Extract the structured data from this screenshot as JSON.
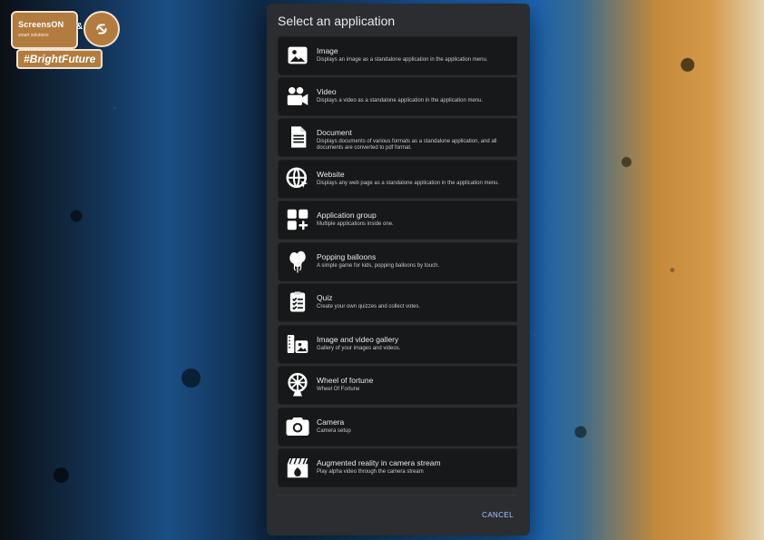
{
  "brand": {
    "left_name": "ScreensON",
    "left_sub": "smart solutions",
    "amp": "&",
    "hashtag": "#BrightFuture"
  },
  "dialog": {
    "title": "Select an application",
    "cancel_label": "CANCEL",
    "items": [
      {
        "icon": "image-icon",
        "title": "Image",
        "desc": "Displays an image as a standalone application in the application menu."
      },
      {
        "icon": "video-camera-icon",
        "title": "Video",
        "desc": "Displays a video as a standalone application in the application menu."
      },
      {
        "icon": "document-icon",
        "title": "Document",
        "desc": "Displays documents of various formats as a standalone application, and all documents are converted to pdf format."
      },
      {
        "icon": "website-globe-icon",
        "title": "Website",
        "desc": "Displays any web page as a standalone application in the application menu."
      },
      {
        "icon": "app-group-icon",
        "title": "Application group",
        "desc": "Multiple applications inside one."
      },
      {
        "icon": "balloons-icon",
        "title": "Popping balloons",
        "desc": "A simple game for kids, popping balloons by touch."
      },
      {
        "icon": "quiz-checklist-icon",
        "title": "Quiz",
        "desc": "Create your own quizzes and collect votes."
      },
      {
        "icon": "gallery-icon",
        "title": "Image and video gallery",
        "desc": "Gallery of your images and videos."
      },
      {
        "icon": "wheel-of-fortune-icon",
        "title": "Wheel of fortune",
        "desc": "Wheel Of Fortune"
      },
      {
        "icon": "camera-icon",
        "title": "Camera",
        "desc": "Camera setup"
      },
      {
        "icon": "clapperboard-ar-icon",
        "title": "Augmented reality in camera stream",
        "desc": "Play alpha video through the camera stream"
      }
    ]
  }
}
